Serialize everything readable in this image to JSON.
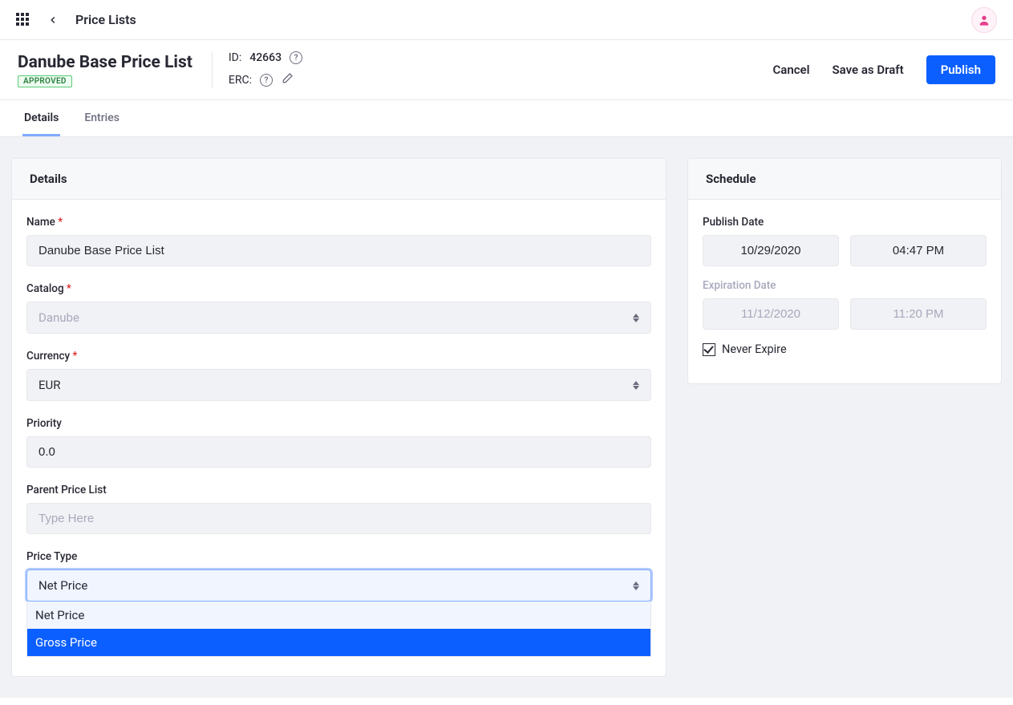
{
  "topbar": {
    "title": "Price Lists"
  },
  "header": {
    "title": "Danube Base Price List",
    "status": "APPROVED",
    "id_label": "ID:",
    "id_value": "42663",
    "erc_label": "ERC:",
    "actions": {
      "cancel": "Cancel",
      "save_draft": "Save as Draft",
      "publish": "Publish"
    }
  },
  "tabs": {
    "details": "Details",
    "entries": "Entries"
  },
  "details": {
    "panel_title": "Details",
    "name": {
      "label": "Name",
      "value": "Danube Base Price List"
    },
    "catalog": {
      "label": "Catalog",
      "value": "Danube"
    },
    "currency": {
      "label": "Currency",
      "value": "EUR"
    },
    "priority": {
      "label": "Priority",
      "value": "0.0"
    },
    "parent": {
      "label": "Parent Price List",
      "placeholder": "Type Here"
    },
    "price_type": {
      "label": "Price Type",
      "value": "Net Price",
      "options": {
        "net": "Net Price",
        "gross": "Gross Price"
      }
    }
  },
  "schedule": {
    "panel_title": "Schedule",
    "publish_label": "Publish Date",
    "publish_date": "10/29/2020",
    "publish_time": "04:47 PM",
    "expire_label": "Expiration Date",
    "expire_date": "11/12/2020",
    "expire_time": "11:20 PM",
    "never_expire": "Never Expire"
  }
}
